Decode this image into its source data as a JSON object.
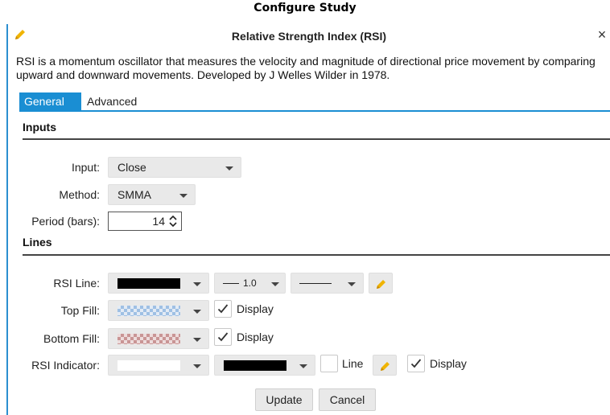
{
  "page_title": "Configure Study",
  "dialog": {
    "title": "Relative Strength Index (RSI)",
    "close_label": "×",
    "description": "RSI is a momentum oscillator that measures the velocity and magnitude of directional price movement by comparing upward and downward movements.  Developed by J Welles Wilder in 1978."
  },
  "tabs": [
    {
      "label": "General",
      "active": true
    },
    {
      "label": "Advanced",
      "active": false
    }
  ],
  "inputs": {
    "section_title": "Inputs",
    "input": {
      "label": "Input:",
      "value": "Close"
    },
    "method": {
      "label": "Method:",
      "value": "SMMA"
    },
    "period": {
      "label": "Period (bars):",
      "value": "14"
    }
  },
  "lines": {
    "section_title": "Lines",
    "rsi_line": {
      "label": "RSI Line:",
      "color": "#000000",
      "width": "1.0"
    },
    "top_fill": {
      "label": "Top Fill:",
      "display_label": "Display",
      "display_checked": true,
      "color": "#9fc0e4"
    },
    "bottom_fill": {
      "label": "Bottom Fill:",
      "display_label": "Display",
      "display_checked": true,
      "color": "#c99595"
    },
    "rsi_indicator": {
      "label": "RSI Indicator:",
      "color1": "#ffffff",
      "color2": "#000000",
      "line_label": "Line",
      "line_checked": false,
      "display_label": "Display",
      "display_checked": true
    }
  },
  "footer": {
    "update_label": "Update",
    "cancel_label": "Cancel"
  },
  "colors": {
    "accent": "#1a8ed3",
    "pencil": "#f0b400"
  },
  "icons": [
    "pencil-icon",
    "close-icon",
    "chevron-down-icon",
    "spinner-icon",
    "checkmark-icon"
  ]
}
